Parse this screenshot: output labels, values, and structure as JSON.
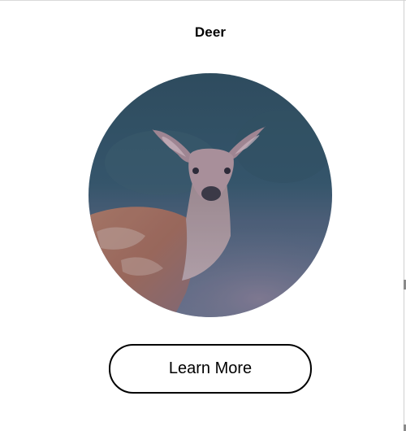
{
  "card": {
    "title": "Deer",
    "image_subject": "deer-photo",
    "button_label": "Learn More"
  },
  "colors": {
    "background": "#ffffff",
    "text": "#000000",
    "photo_tint": "#3f5570",
    "button_border": "#000000"
  }
}
